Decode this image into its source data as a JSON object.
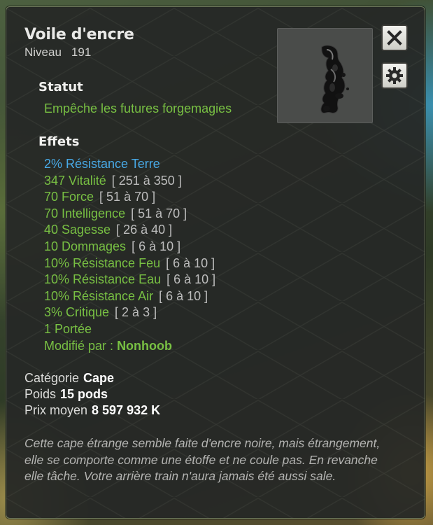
{
  "item": {
    "name": "Voile d'encre",
    "level_label": "Niveau",
    "level_value": "191"
  },
  "status": {
    "heading": "Statut",
    "text": "Empêche les futures forgemagies"
  },
  "effects": {
    "heading": "Effets",
    "list": [
      {
        "text": "2% Résistance Terre",
        "range": "",
        "color": "blue"
      },
      {
        "text": "347 Vitalité",
        "range": "[ 251 à 350 ]",
        "color": "green"
      },
      {
        "text": "70 Force",
        "range": "[ 51 à 70 ]",
        "color": "green"
      },
      {
        "text": "70 Intelligence",
        "range": "[ 51 à 70 ]",
        "color": "green"
      },
      {
        "text": "40 Sagesse",
        "range": "[ 26 à 40 ]",
        "color": "green"
      },
      {
        "text": "10 Dommages",
        "range": "[ 6 à 10 ]",
        "color": "green"
      },
      {
        "text": "10% Résistance Feu",
        "range": "[ 6 à 10 ]",
        "color": "green"
      },
      {
        "text": "10% Résistance Eau",
        "range": "[ 6 à 10 ]",
        "color": "green"
      },
      {
        "text": "10% Résistance Air",
        "range": "[ 6 à 10 ]",
        "color": "green"
      },
      {
        "text": "3% Critique",
        "range": "[ 2 à 3 ]",
        "color": "green"
      },
      {
        "text": "1 Portée",
        "range": "",
        "color": "green"
      }
    ],
    "modified_by_label": "Modifié par :",
    "modified_by_name": "Nonhoob"
  },
  "details": {
    "category_label": "Catégorie",
    "category_value": "Cape",
    "weight_label": "Poids",
    "weight_value": "15 pods",
    "price_label": "Prix moyen",
    "price_value": "8 597 932 K"
  },
  "description": "Cette cape étrange semble faite d'encre noire, mais étrangement, elle se comporte comme une étoffe et ne coule pas. En revanche elle tâche. Votre arrière train n'aura jamais été aussi sale.",
  "icons": {
    "close": "close-icon",
    "settings": "gear-icon",
    "item": "ink-veil-item-icon"
  },
  "colors": {
    "bonus_blue": "#48a9e6",
    "effect_green": "#78c043",
    "range_grey": "#bdbdbd"
  }
}
